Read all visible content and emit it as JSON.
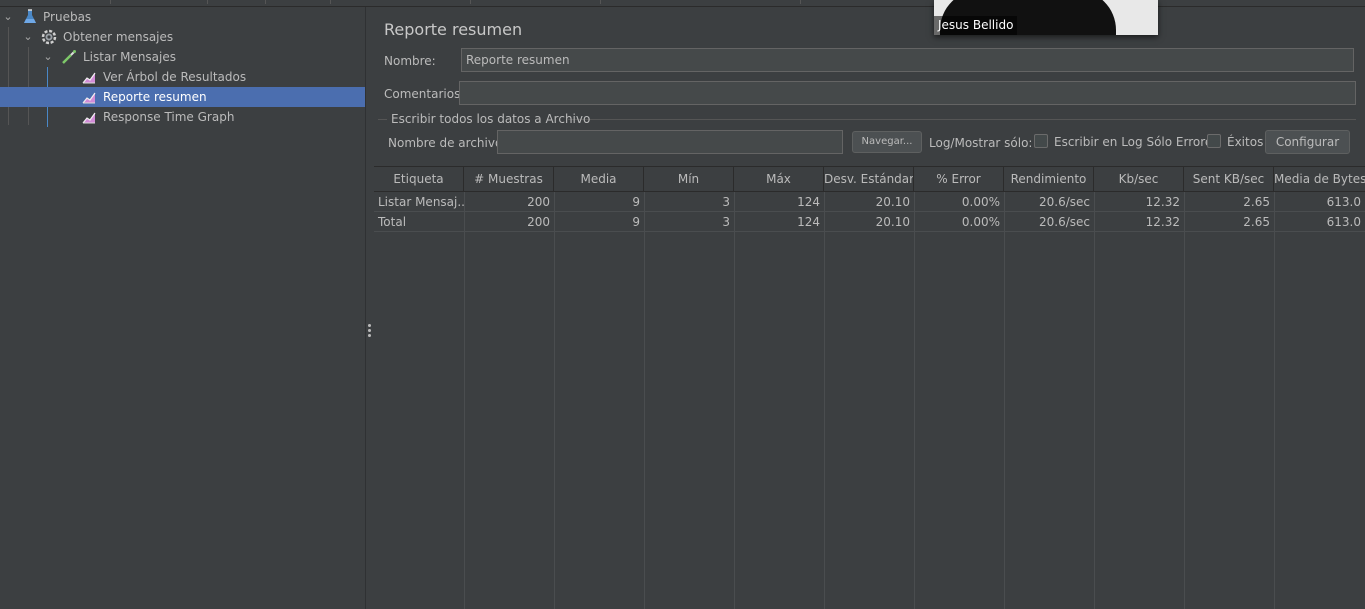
{
  "tree": {
    "items": [
      {
        "label": "Pruebas",
        "icon": "flask-icon"
      },
      {
        "label": "Obtener mensajes",
        "icon": "gear-icon"
      },
      {
        "label": "Listar Mensajes",
        "icon": "pipette-icon"
      },
      {
        "label": "Ver Árbol de Resultados",
        "icon": "graph-icon"
      },
      {
        "label": "Reporte resumen",
        "icon": "graph-icon",
        "selected": true
      },
      {
        "label": "Response Time Graph",
        "icon": "graph-icon"
      }
    ]
  },
  "panel": {
    "title": "Reporte resumen",
    "name_label": "Nombre:",
    "name_value": "Reporte resumen",
    "comments_label": "Comentarios",
    "comments_value": "",
    "write_group_label": "Escribir todos los datos a Archivo",
    "filename_label": "Nombre de archivo",
    "filename_value": "",
    "browse_label": "Navegar...",
    "log_label": "Log/Mostrar sólo:",
    "errors_only_label": "Escribir en Log Sólo Errores",
    "success_label": "Éxitos",
    "configure_label": "Configurar"
  },
  "table": {
    "headers": [
      "Etiqueta",
      "# Muestras",
      "Media",
      "Mín",
      "Máx",
      "Desv. Estándar",
      "% Error",
      "Rendimiento",
      "Kb/sec",
      "Sent KB/sec",
      "Media de Bytes"
    ],
    "rows": [
      [
        "Listar Mensaj...",
        "200",
        "9",
        "3",
        "124",
        "20.10",
        "0.00%",
        "20.6/sec",
        "12.32",
        "2.65",
        "613.0"
      ],
      [
        "Total",
        "200",
        "9",
        "3",
        "124",
        "20.10",
        "0.00%",
        "20.6/sec",
        "12.32",
        "2.65",
        "613.0"
      ]
    ]
  },
  "video": {
    "name": "Jesus Bellido"
  },
  "colors": {
    "background": "#3c3f41",
    "selection": "#4b6eaf",
    "tree_guide": "#4a88c7"
  }
}
